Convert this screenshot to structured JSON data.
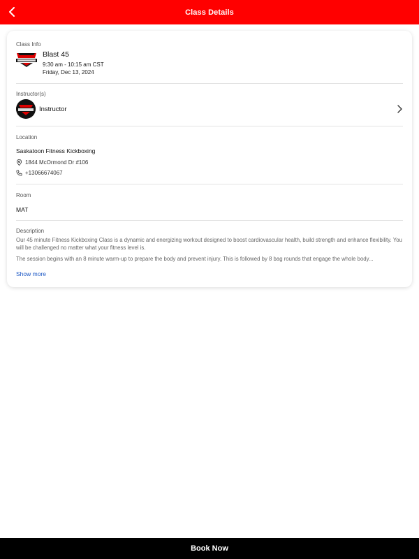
{
  "header": {
    "title": "Class Details",
    "back_icon": "chevron-left-icon",
    "background": "#ff0000"
  },
  "class_info": {
    "section_label": "Class Info",
    "name": "Blast 45",
    "time": "9:30 am - 10:15 am CST",
    "date": "Friday, Dec 13, 2024",
    "logo_icon": "kickboxing-logo-icon"
  },
  "instructor": {
    "section_label": "Instructor(s)",
    "name": "Instructor",
    "avatar_icon": "kickboxing-logo-avatar",
    "chevron_icon": "chevron-right-icon"
  },
  "location": {
    "section_label": "Location",
    "name": "Saskatoon Fitness Kickboxing",
    "address": "1844 McOrmond Dr #106",
    "phone": "+13066674067",
    "address_icon": "map-pin-icon",
    "phone_icon": "phone-icon"
  },
  "room": {
    "section_label": "Room",
    "value": "MAT"
  },
  "description": {
    "section_label": "Description",
    "paragraph1": "Our 45 minute Fitness Kickboxing Class is a dynamic and energizing workout designed to boost cardiovascular health, build strength and enhance flexibility. You will be challenged no matter what your fitness level is.",
    "paragraph2": "The session begins with an 8 minute warm-up to prepare the body and prevent injury. This is followed by 8 bag rounds that engage the whole body...",
    "show_more": "Show more",
    "link_color": "#1a56c4"
  },
  "footer": {
    "book_label": "Book Now",
    "background": "#000000"
  }
}
